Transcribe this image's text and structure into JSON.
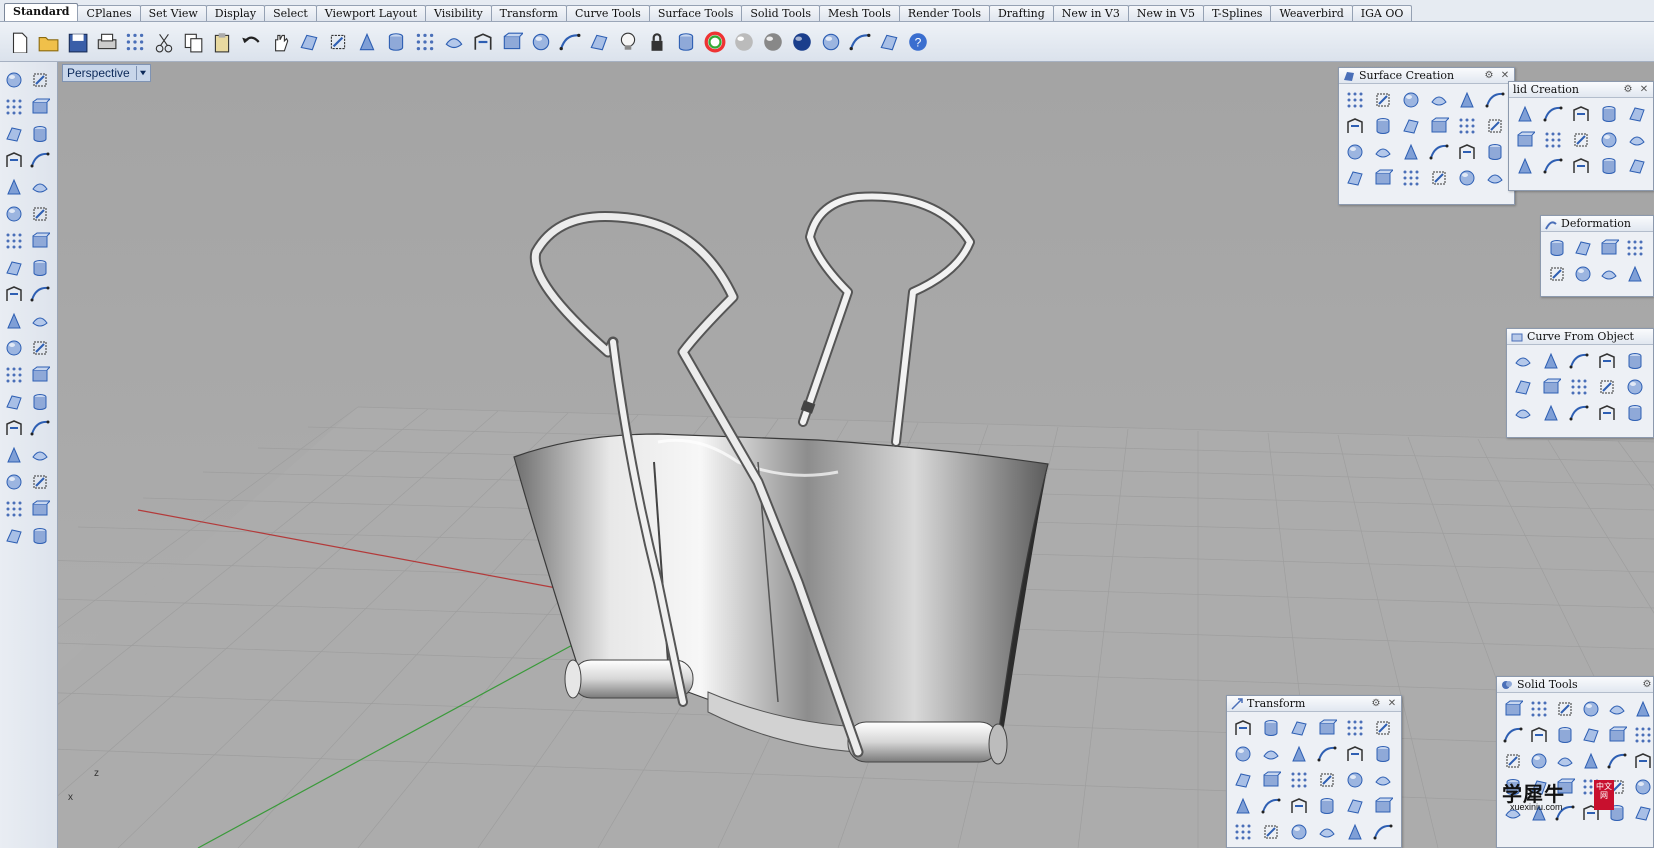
{
  "tabs": [
    "Standard",
    "CPlanes",
    "Set View",
    "Display",
    "Select",
    "Viewport Layout",
    "Visibility",
    "Transform",
    "Curve Tools",
    "Surface Tools",
    "Solid Tools",
    "Mesh Tools",
    "Render Tools",
    "Drafting",
    "New in V3",
    "New in V5",
    "T-Splines",
    "Weaverbird",
    "IGA OO"
  ],
  "active_tab": "Standard",
  "toolbar_icons": [
    "new-file-icon",
    "open-folder-icon",
    "save-icon",
    "print-icon",
    "import-icon",
    "cut-icon",
    "copy-icon",
    "paste-icon",
    "undo-icon",
    "pan-hand-icon",
    "rotate-view-icon",
    "zoom-icon",
    "zoom-window-icon",
    "zoom-extents-icon",
    "zoom-selected-icon",
    "undo-view-icon",
    "four-viewports-icon",
    "car-icon",
    "named-view-icon",
    "cplane-icon",
    "osnap-icon",
    "light-bulb-icon",
    "lock-icon",
    "layer-icon",
    "color-wheel-icon",
    "render-sphere-icon",
    "shaded-sphere-icon",
    "blue-sphere-icon",
    "select-filter-icon",
    "options-gear-icon",
    "dimension-icon",
    "help-icon"
  ],
  "left_tools": [
    "select-arrow-icon",
    "point-icon",
    "polyline-icon",
    "curve-cv-icon",
    "circle-icon",
    "ellipse-icon",
    "polygon-icon",
    "rectangle-icon",
    "arc-icon",
    "curve-icon",
    "surface-corner-icon",
    "surface-loft-icon",
    "box-solid-icon",
    "boolean-icon",
    "cylinder-icon",
    "mesh-plane-icon",
    "explode-icon",
    "trim-icon",
    "split-icon",
    "join-icon",
    "group-icon",
    "spheres-icon",
    "fillet-icon",
    "offset-icon",
    "text-icon",
    "scale-icon",
    "array-icon",
    "align-icon",
    "solid-edit-icon",
    "dimension-icon",
    "grid-array-icon",
    "mirror-icon",
    "blue-shape-icon",
    "check-icon",
    "render-icon",
    "paint-icon"
  ],
  "viewport": {
    "title": "Perspective",
    "axis_z": "z",
    "axis_x": "x"
  },
  "palettes": {
    "surface_creation": {
      "title": "Surface Creation"
    },
    "solid_creation": {
      "title": "lid Creation"
    },
    "deformation": {
      "title": "Deformation"
    },
    "curve_from_object": {
      "title": "Curve From Object"
    },
    "transform": {
      "title": "Transform"
    },
    "solid_tools": {
      "title": "Solid Tools"
    }
  },
  "watermark": {
    "main": "学犀牛",
    "sub": "xuexiniu.com",
    "badge": "中文网"
  },
  "colors": {
    "accent": "#2e5fb3",
    "viewport_bg": "#a8a8a8",
    "grid": "#9a9a9a",
    "x_axis": "#b33a3a",
    "y_axis": "#3a9a3a"
  }
}
